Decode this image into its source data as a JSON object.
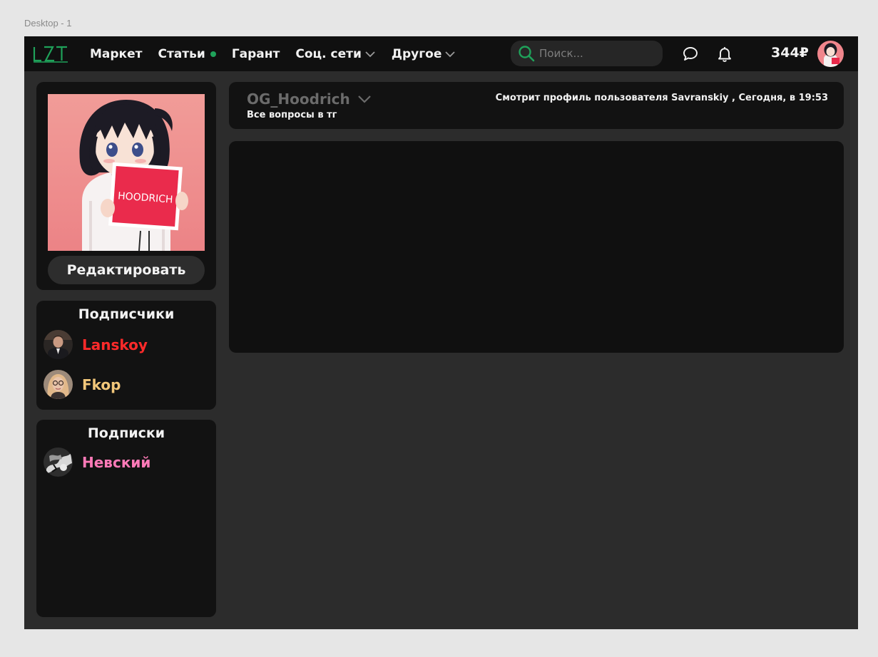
{
  "canvas": {
    "frame_label": "Desktop - 1"
  },
  "header": {
    "logo_text": "LZT",
    "nav": [
      {
        "label": "Маркет"
      },
      {
        "label": "Статьи"
      },
      {
        "label": "Гарант"
      },
      {
        "label": "Соц. сети"
      },
      {
        "label": "Другое"
      }
    ],
    "search": {
      "placeholder": "Поиск..."
    },
    "balance": "344₽",
    "accent_color": "#1fa25a"
  },
  "profile_card": {
    "edit_label": "Редактировать"
  },
  "followers": {
    "title": "Подписчики",
    "users": [
      {
        "name": "Lanskoy",
        "color": "#ff2a2a"
      },
      {
        "name": "Fkop",
        "color": "#f2c77a"
      }
    ]
  },
  "subscriptions": {
    "title": "Подписки",
    "users": [
      {
        "name": "Невский",
        "color": "#ff7ab8"
      }
    ]
  },
  "profile": {
    "username": "OG_Hoodrich",
    "status": "Все вопросы в тг",
    "viewing": "Смотрит профиль пользователя Savranskiy , Сегодня, в 19:53"
  },
  "avatar_sign_text": "HOODRICH"
}
